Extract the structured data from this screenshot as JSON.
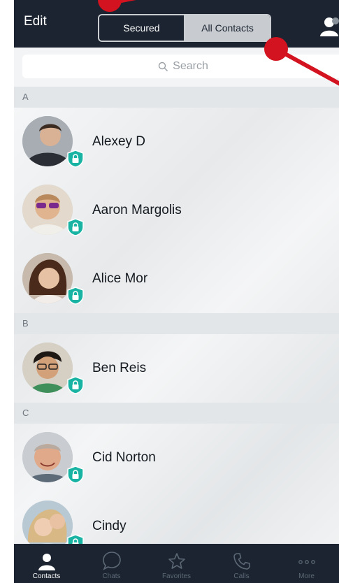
{
  "navbar": {
    "edit_label": "Edit",
    "segments": {
      "secured": "Secured",
      "all_contacts": "All Contacts"
    },
    "selected_segment": "Secured"
  },
  "search": {
    "placeholder": "Search"
  },
  "sections": [
    {
      "letter": "A",
      "contacts": [
        {
          "name": "Alexey D",
          "secured": true
        },
        {
          "name": "Aaron Margolis",
          "secured": true
        },
        {
          "name": "Alice Mor",
          "secured": true
        }
      ]
    },
    {
      "letter": "B",
      "contacts": [
        {
          "name": "Ben Reis",
          "secured": true
        }
      ]
    },
    {
      "letter": "C",
      "contacts": [
        {
          "name": "Cid Norton",
          "secured": true
        },
        {
          "name": "Cindy",
          "secured": true
        }
      ]
    }
  ],
  "tabs": [
    {
      "label": "Contacts",
      "icon": "person-icon",
      "active": true
    },
    {
      "label": "Chats",
      "icon": "chat-bubble-icon",
      "active": false
    },
    {
      "label": "Favorites",
      "icon": "star-icon",
      "active": false
    },
    {
      "label": "Calls",
      "icon": "phone-icon",
      "active": false
    },
    {
      "label": "More",
      "icon": "more-dots-icon",
      "active": false
    }
  ],
  "colors": {
    "navbar_bg": "#1b2430",
    "shield": "#18b3a2",
    "annotation": "#d3131f",
    "tab_active": "#ffffff",
    "tab_inactive": "#5c6876"
  }
}
